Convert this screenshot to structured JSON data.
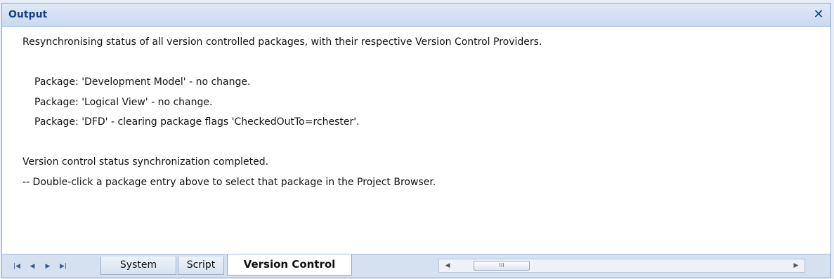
{
  "window": {
    "title": "Output",
    "close_glyph": "✕"
  },
  "output": {
    "lines": [
      "Resynchronising status of all version controlled packages, with their respective Version Control Providers.",
      "",
      "Package: 'Development Model' - no change.",
      "Package: 'Logical View' - no change.",
      "Package: 'DFD' - clearing package flags 'CheckedOutTo=rchester'.",
      "",
      "Version control status synchronization completed.",
      "-- Double-click a package entry above to select that package in the Project Browser."
    ]
  },
  "nav": {
    "first_icon": "first-tab-icon",
    "prev_icon": "previous-tab-icon",
    "next_icon": "next-tab-icon",
    "last_icon": "last-tab-icon"
  },
  "tabs": [
    {
      "label": "System",
      "active": false
    },
    {
      "label": "Script",
      "active": false
    },
    {
      "label": "Version Control",
      "active": true
    }
  ],
  "scrollbar": {
    "thumb_grip": "III"
  },
  "colors": {
    "title_text": "#15428b",
    "titlebar_bg": "#d4e2f4",
    "bottombar_bg": "#d5e1f1"
  }
}
